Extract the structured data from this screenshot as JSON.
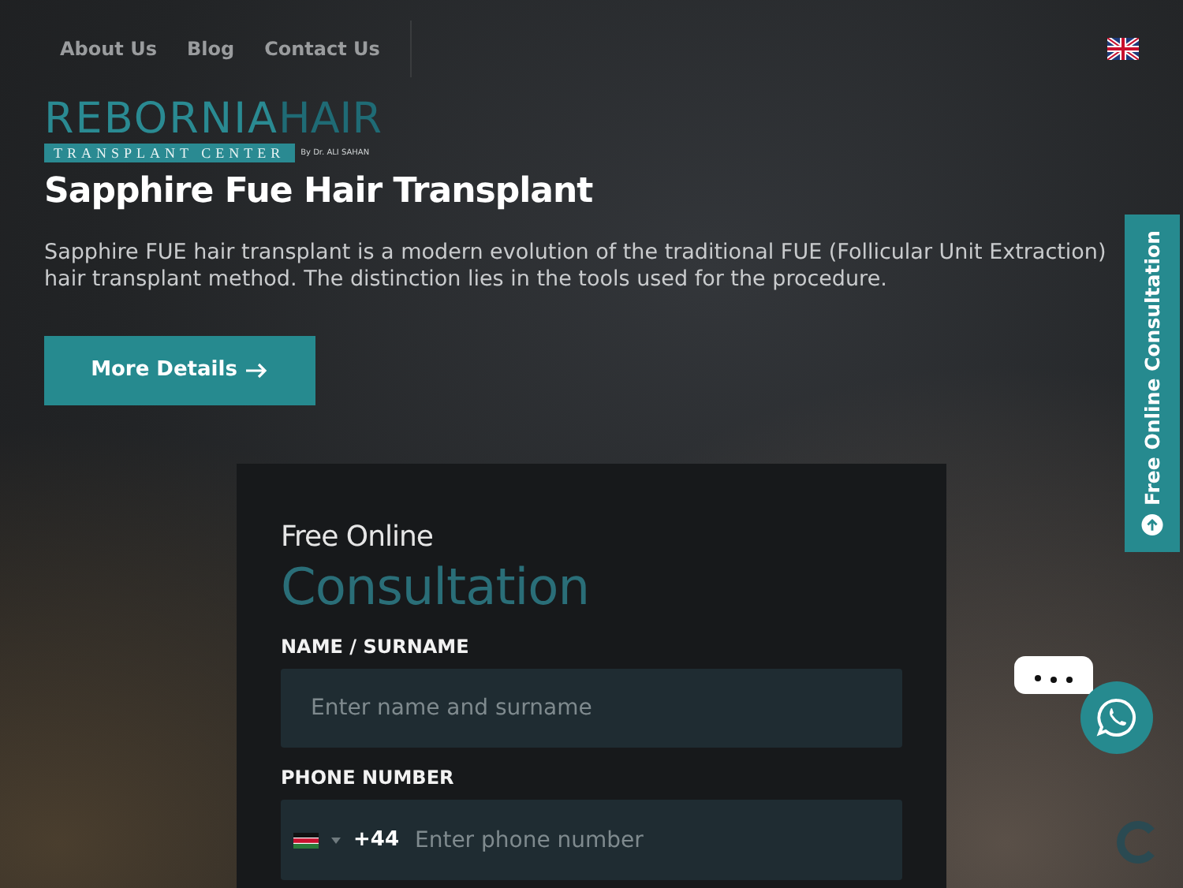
{
  "nav": {
    "links": [
      "About Us",
      "Blog",
      "Contact Us"
    ]
  },
  "logo": {
    "brand": "REBORNIA",
    "brand_accent": "HAIR",
    "tagline": "TRANSPLANT CENTER",
    "byline": "By Dr. ALI SAHAN"
  },
  "hero": {
    "title": "Sapphire Fue Hair Transplant",
    "text": "Sapphire FUE hair transplant is a modern evolution of the traditional FUE (Follicular Unit Extraction) hair transplant method. The distinction lies in the tools used for the procedure.",
    "button": "More Details"
  },
  "form": {
    "kicker": "Free Online",
    "title": "Consultation",
    "fields": [
      {
        "kind": "text",
        "label": "NAME / SURNAME",
        "placeholder": "Enter name and surname"
      },
      {
        "kind": "phone",
        "label": "PHONE NUMBER",
        "code": "+44",
        "placeholder": "Enter phone number"
      }
    ]
  },
  "side_tab": {
    "label": "Free Online Consultation"
  }
}
